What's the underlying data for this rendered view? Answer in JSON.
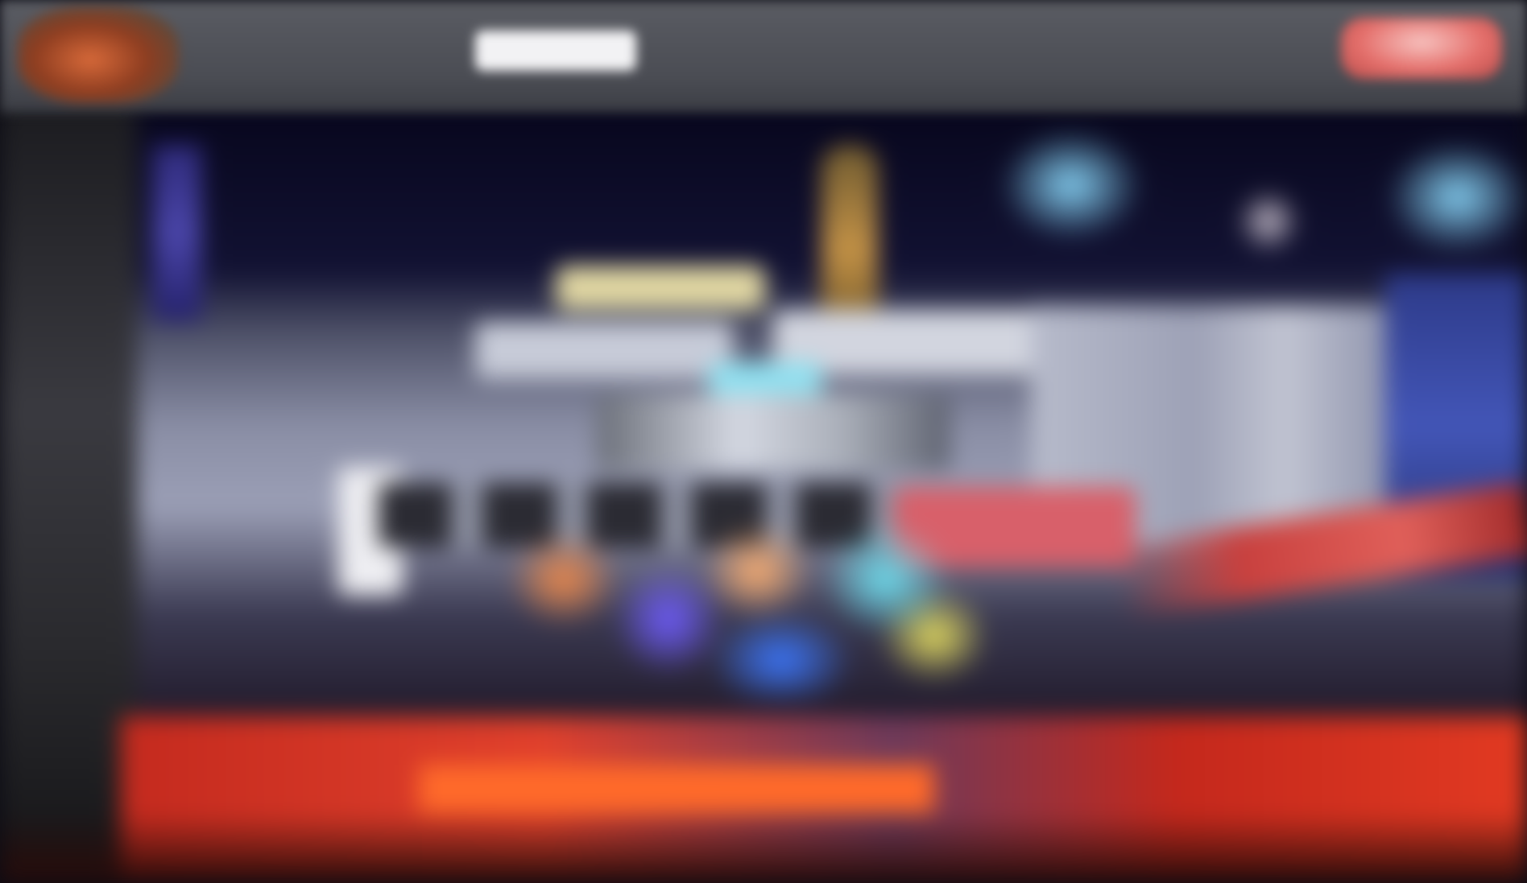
{
  "header": {
    "brand_text": "",
    "logo_icon": "brand-logo-icon",
    "cta_label": ""
  },
  "nav": {
    "items": [
      {
        "label": ""
      },
      {
        "label": ""
      },
      {
        "label": ""
      },
      {
        "label": ""
      },
      {
        "label": ""
      }
    ],
    "active_index": 0
  },
  "hero": {
    "image_icon": "hero-city-photo"
  },
  "colors": {
    "topbar": "#4a4c53",
    "cta": "#e46e6a",
    "floor_red": "#c42a1e"
  }
}
